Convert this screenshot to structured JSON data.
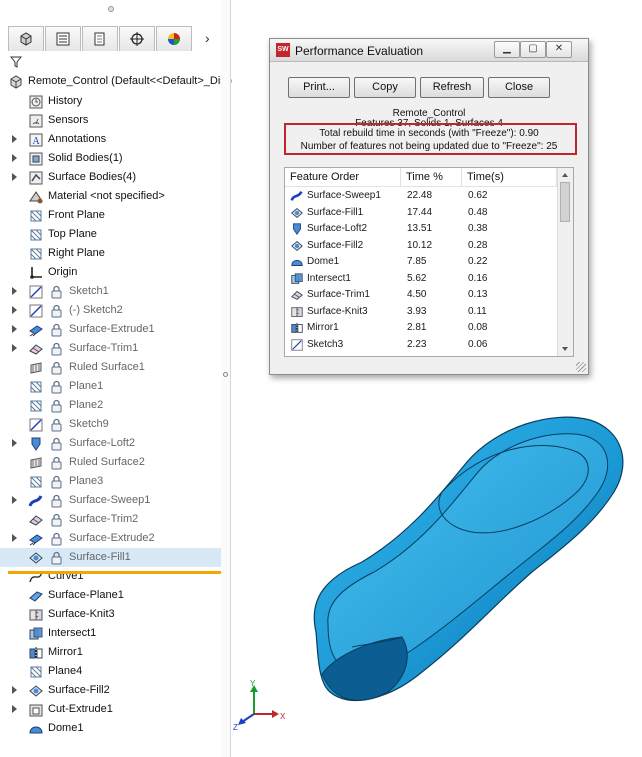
{
  "tree_tabs": [
    "feature-manager-icon",
    "property-manager-icon",
    "configuration-manager-icon",
    "dimxpert-icon",
    "display-manager-icon"
  ],
  "tree_root": "Remote_Control  (Default<<Default>_Disp",
  "tree": [
    {
      "label": "History",
      "icon": "history-icon",
      "expand": false,
      "lock": false,
      "dim": false
    },
    {
      "label": "Sensors",
      "icon": "sensor-icon",
      "expand": false,
      "lock": false,
      "dim": false
    },
    {
      "label": "Annotations",
      "icon": "annotation-icon",
      "expand": true,
      "lock": false,
      "dim": false
    },
    {
      "label": "Solid Bodies(1)",
      "icon": "solid-body-icon",
      "expand": true,
      "lock": false,
      "dim": false
    },
    {
      "label": "Surface Bodies(4)",
      "icon": "surface-body-icon",
      "expand": true,
      "lock": false,
      "dim": false
    },
    {
      "label": "Material <not specified>",
      "icon": "material-icon",
      "expand": false,
      "lock": false,
      "dim": false
    },
    {
      "label": "Front Plane",
      "icon": "plane-icon",
      "expand": false,
      "lock": false,
      "dim": false
    },
    {
      "label": "Top Plane",
      "icon": "plane-icon",
      "expand": false,
      "lock": false,
      "dim": false
    },
    {
      "label": "Right Plane",
      "icon": "plane-icon",
      "expand": false,
      "lock": false,
      "dim": false
    },
    {
      "label": "Origin",
      "icon": "origin-icon",
      "expand": false,
      "lock": false,
      "dim": false
    },
    {
      "label": "Sketch1",
      "icon": "sketch-icon",
      "expand": true,
      "lock": true,
      "dim": true
    },
    {
      "label": "(-) Sketch2",
      "icon": "sketch-icon",
      "expand": true,
      "lock": true,
      "dim": true
    },
    {
      "label": "Surface-Extrude1",
      "icon": "surface-extrude-icon",
      "expand": true,
      "lock": true,
      "dim": true
    },
    {
      "label": "Surface-Trim1",
      "icon": "surface-trim-icon",
      "expand": true,
      "lock": true,
      "dim": true
    },
    {
      "label": "Ruled Surface1",
      "icon": "ruled-surface-icon",
      "expand": false,
      "lock": true,
      "dim": true
    },
    {
      "label": "Plane1",
      "icon": "plane-icon",
      "expand": false,
      "lock": true,
      "dim": true
    },
    {
      "label": "Plane2",
      "icon": "plane-icon",
      "expand": false,
      "lock": true,
      "dim": true
    },
    {
      "label": "Sketch9",
      "icon": "sketch-icon",
      "expand": false,
      "lock": true,
      "dim": true
    },
    {
      "label": "Surface-Loft2",
      "icon": "surface-loft-icon",
      "expand": true,
      "lock": true,
      "dim": true
    },
    {
      "label": "Ruled Surface2",
      "icon": "ruled-surface-icon",
      "expand": false,
      "lock": true,
      "dim": true
    },
    {
      "label": "Plane3",
      "icon": "plane-icon",
      "expand": false,
      "lock": true,
      "dim": true
    },
    {
      "label": "Surface-Sweep1",
      "icon": "surface-sweep-icon",
      "expand": true,
      "lock": true,
      "dim": true
    },
    {
      "label": "Surface-Trim2",
      "icon": "surface-trim-icon",
      "expand": false,
      "lock": true,
      "dim": true
    },
    {
      "label": "Surface-Extrude2",
      "icon": "surface-extrude-icon",
      "expand": true,
      "lock": true,
      "dim": true
    },
    {
      "label": "Surface-Fill1",
      "icon": "surface-fill-icon",
      "expand": false,
      "lock": true,
      "dim": true,
      "selected": true
    },
    {
      "label": "Curve1",
      "icon": "curve-icon",
      "expand": false,
      "lock": false,
      "dim": false
    },
    {
      "label": "Surface-Plane1",
      "icon": "surface-plane-icon",
      "expand": false,
      "lock": false,
      "dim": false
    },
    {
      "label": "Surface-Knit3",
      "icon": "surface-knit-icon",
      "expand": false,
      "lock": false,
      "dim": false
    },
    {
      "label": "Intersect1",
      "icon": "intersect-icon",
      "expand": false,
      "lock": false,
      "dim": false
    },
    {
      "label": "Mirror1",
      "icon": "mirror-icon",
      "expand": false,
      "lock": false,
      "dim": false
    },
    {
      "label": "Plane4",
      "icon": "plane-icon",
      "expand": false,
      "lock": false,
      "dim": false
    },
    {
      "label": "Surface-Fill2",
      "icon": "surface-fill-icon",
      "expand": true,
      "lock": false,
      "dim": false
    },
    {
      "label": "Cut-Extrude1",
      "icon": "cut-extrude-icon",
      "expand": true,
      "lock": false,
      "dim": false
    },
    {
      "label": "Dome1",
      "icon": "dome-icon",
      "expand": false,
      "lock": false,
      "dim": false
    }
  ],
  "dialog": {
    "title": "Performance Evaluation",
    "buttons": {
      "print": "Print...",
      "copy": "Copy",
      "refresh": "Refresh",
      "close": "Close"
    },
    "model_name": "Remote_Control",
    "counts": "Features 37, Solids 1, Surfaces 4",
    "rebuild_time": "Total rebuild time in seconds (with \"Freeze\"): 0.90",
    "frozen_count": "Number of features not being updated due to \"Freeze\": 25",
    "columns": [
      "Feature Order",
      "Time %",
      "Time(s)"
    ],
    "rows": [
      {
        "name": "Surface-Sweep1",
        "pct": "22.48",
        "secs": "0.62",
        "icon": "surface-sweep-icon"
      },
      {
        "name": "Surface-Fill1",
        "pct": "17.44",
        "secs": "0.48",
        "icon": "surface-fill-icon"
      },
      {
        "name": "Surface-Loft2",
        "pct": "13.51",
        "secs": "0.38",
        "icon": "surface-loft-icon"
      },
      {
        "name": "Surface-Fill2",
        "pct": "10.12",
        "secs": "0.28",
        "icon": "surface-fill-icon"
      },
      {
        "name": "Dome1",
        "pct": "7.85",
        "secs": "0.22",
        "icon": "dome-icon"
      },
      {
        "name": "Intersect1",
        "pct": "5.62",
        "secs": "0.16",
        "icon": "intersect-icon"
      },
      {
        "name": "Surface-Trim1",
        "pct": "4.50",
        "secs": "0.13",
        "icon": "surface-trim-icon"
      },
      {
        "name": "Surface-Knit3",
        "pct": "3.93",
        "secs": "0.11",
        "icon": "surface-knit-icon"
      },
      {
        "name": "Mirror1",
        "pct": "2.81",
        "secs": "0.08",
        "icon": "mirror-icon"
      },
      {
        "name": "Sketch3",
        "pct": "2.23",
        "secs": "0.06",
        "icon": "sketch-icon"
      }
    ]
  },
  "triad": {
    "x": "X",
    "y": "Y",
    "z": "Z"
  },
  "colors": {
    "model_body": "#1b9ad6",
    "model_dark": "#0c5d92",
    "rollback_bar": "#f0a800",
    "highlight": "#c0262b",
    "tree_selected": "#d7e9f7"
  }
}
